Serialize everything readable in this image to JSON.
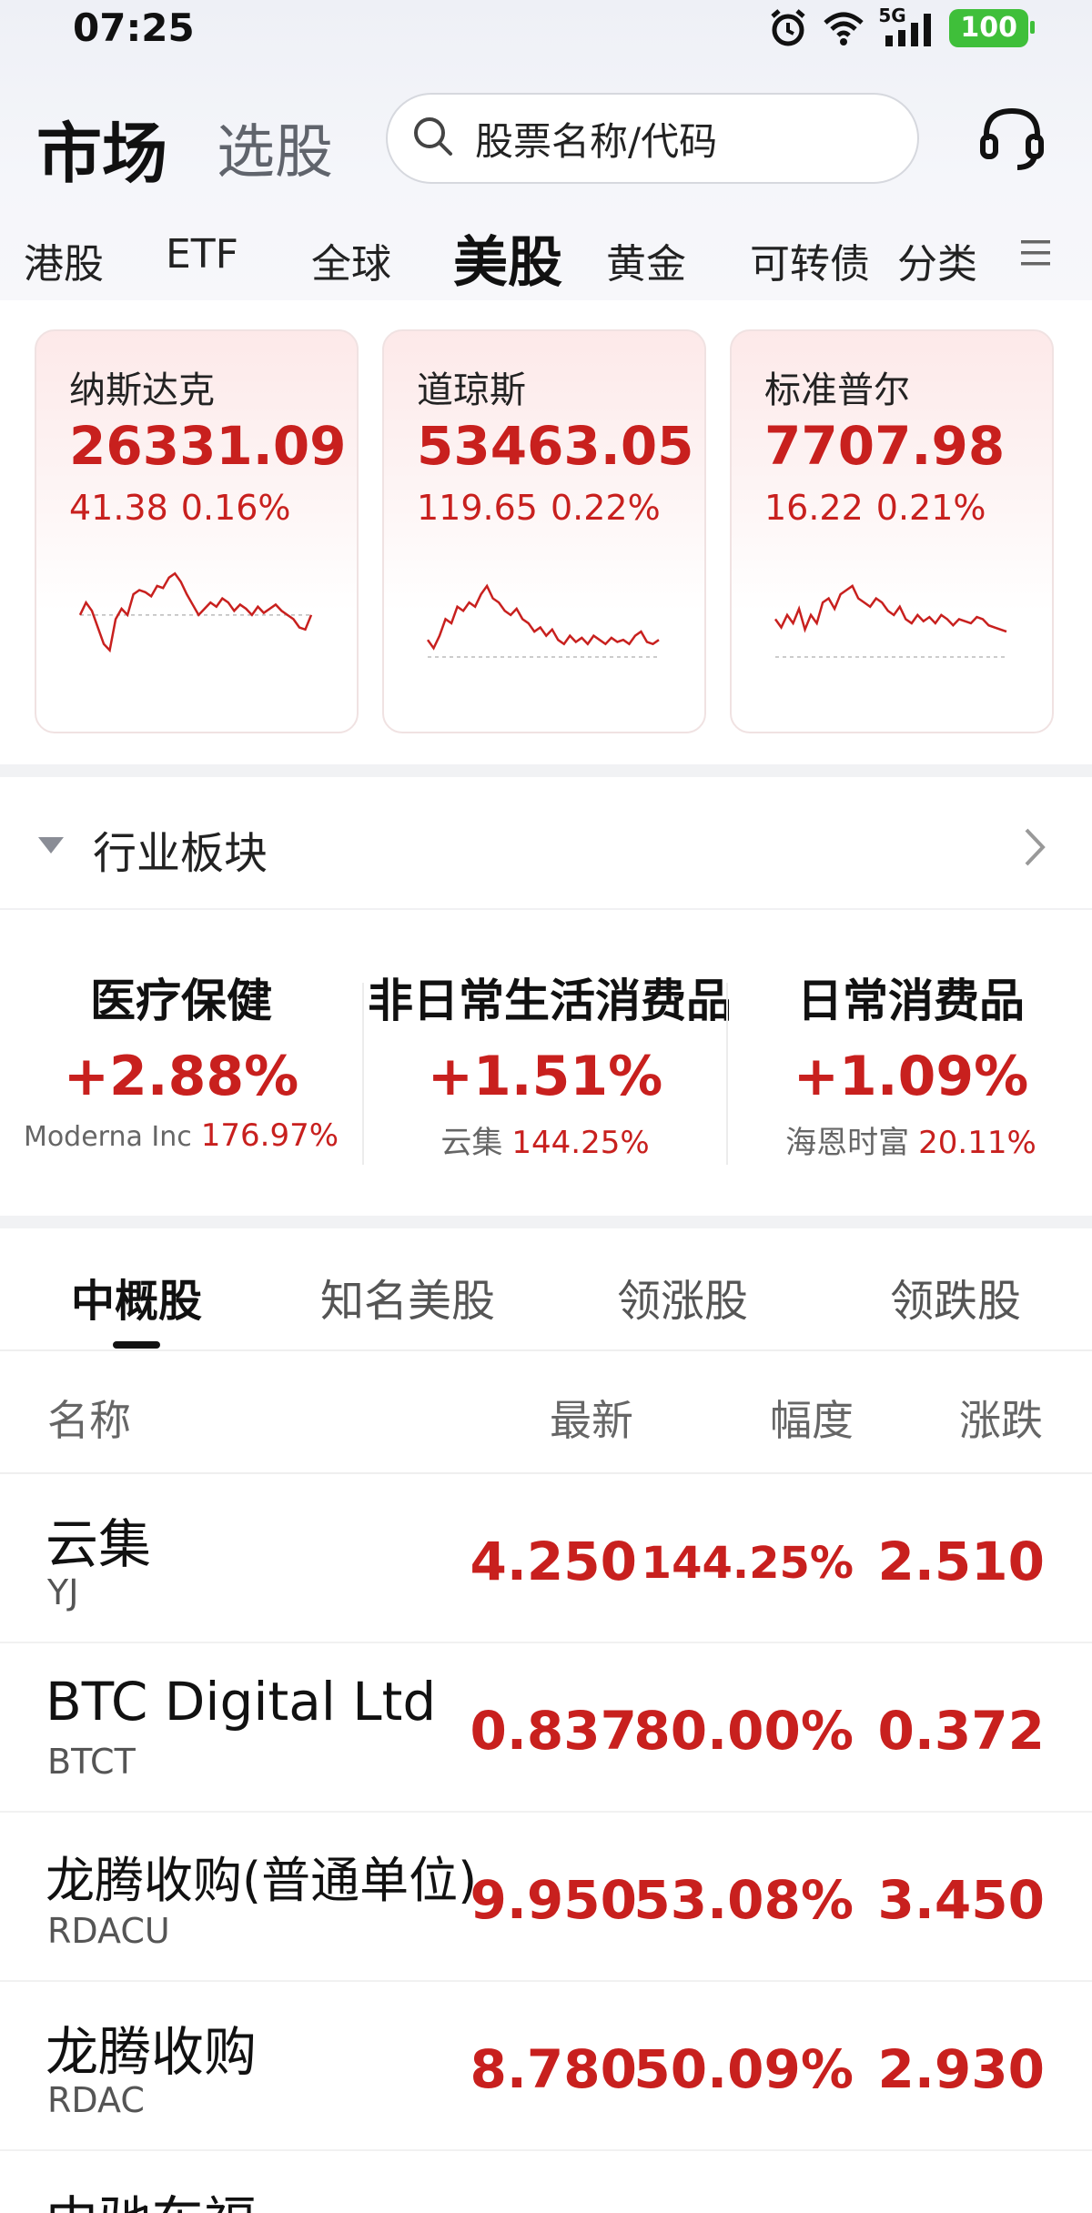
{
  "status_bar": {
    "time": "07:25",
    "network": "5G",
    "battery": "100"
  },
  "header": {
    "title": "市场",
    "secondary_title": "选股",
    "search_placeholder": "股票名称/代码"
  },
  "market_tabs": [
    {
      "label": "港股"
    },
    {
      "label": "ETF"
    },
    {
      "label": "全球"
    },
    {
      "label": "美股",
      "active": true
    },
    {
      "label": "黄金"
    },
    {
      "label": "可转债"
    },
    {
      "label": "分类"
    }
  ],
  "indices": [
    {
      "name": "纳斯达克",
      "price": "26331.09",
      "change": "41.38",
      "pct": "0.16%",
      "chart_data": {
        "type": "line",
        "values": [
          52,
          58,
          54,
          46,
          38,
          35,
          50,
          55,
          52,
          62,
          64,
          63,
          61,
          66,
          65,
          70,
          72,
          68,
          62,
          57,
          52,
          55,
          58,
          56,
          60,
          58,
          54,
          57,
          55,
          52,
          56,
          53,
          55,
          57,
          54,
          52,
          50,
          46,
          45,
          52
        ]
      }
    },
    {
      "name": "道琼斯",
      "price": "53463.05",
      "change": "119.65",
      "pct": "0.22%",
      "chart_data": {
        "type": "line",
        "values": [
          40,
          36,
          42,
          50,
          48,
          56,
          54,
          58,
          56,
          62,
          66,
          60,
          58,
          54,
          52,
          55,
          50,
          48,
          44,
          46,
          42,
          45,
          40,
          38,
          42,
          39,
          41,
          38,
          42,
          40,
          38,
          41,
          39,
          40,
          38,
          42,
          44,
          39,
          38,
          40
        ]
      }
    },
    {
      "name": "标准普尔",
      "price": "7707.98",
      "change": "16.22",
      "pct": "0.21%",
      "chart_data": {
        "type": "line",
        "values": [
          50,
          46,
          52,
          48,
          55,
          45,
          52,
          48,
          58,
          60,
          55,
          62,
          64,
          66,
          60,
          58,
          56,
          60,
          58,
          54,
          52,
          56,
          50,
          48,
          52,
          49,
          51,
          48,
          52,
          50,
          47,
          50,
          49,
          48,
          51,
          50,
          47,
          46,
          45,
          44
        ]
      }
    }
  ],
  "sector_section": {
    "title": "行业板块"
  },
  "sectors": [
    {
      "name": "医疗保健",
      "pct": "+2.88%",
      "leader": "Moderna Inc",
      "leader_pct": "176.97%"
    },
    {
      "name": "非日常生活消费品",
      "pct": "+1.51%",
      "leader": "云集",
      "leader_pct": "144.25%"
    },
    {
      "name": "日常消费品",
      "pct": "+1.09%",
      "leader": "海恩时富",
      "leader_pct": "20.11%"
    }
  ],
  "list_tabs": [
    {
      "label": "中概股",
      "active": true
    },
    {
      "label": "知名美股"
    },
    {
      "label": "领涨股"
    },
    {
      "label": "领跌股"
    }
  ],
  "table": {
    "headers": {
      "name": "名称",
      "latest": "最新",
      "range": "幅度",
      "change": "涨跌"
    },
    "rows": [
      {
        "name": "云集",
        "code": "YJ",
        "latest": "4.250",
        "range": "144.25%",
        "change": "2.510"
      },
      {
        "name": "BTC Digital Ltd",
        "code": "BTCT",
        "latest": "0.837",
        "range": "80.00%",
        "change": "0.372"
      },
      {
        "name": "龙腾收购(普通单位)",
        "code": "RDACU",
        "latest": "9.950",
        "range": "53.08%",
        "change": "3.450"
      },
      {
        "name": "龙腾收购",
        "code": "RDAC",
        "latest": "8.780",
        "range": "50.09%",
        "change": "2.930"
      },
      {
        "name": "中驰车福",
        "code": "",
        "latest": "",
        "range": "",
        "change": ""
      }
    ]
  },
  "colors": {
    "up": "#c8201e",
    "text": "#111111",
    "muted": "#666666"
  }
}
